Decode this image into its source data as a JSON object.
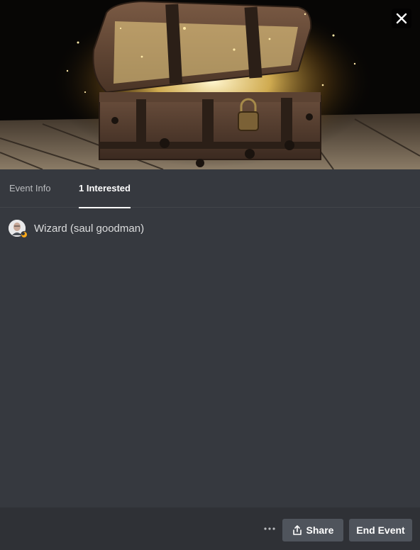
{
  "cover": {
    "image_subject": "open treasure chest glowing with golden light"
  },
  "close": {
    "icon": "close-icon"
  },
  "tabs": [
    {
      "label": "Event Info",
      "active": false
    },
    {
      "label": "1 Interested",
      "active": true
    }
  ],
  "interested": [
    {
      "name": "Wizard (saul goodman)",
      "avatar": "avatar-icon",
      "badge": "moon-status-icon"
    }
  ],
  "footer": {
    "more_label": "•••",
    "share_label": "Share",
    "end_label": "End Event"
  },
  "colors": {
    "background": "#36393f",
    "footer": "#2f3136",
    "button": "#4f545c",
    "idle_status": "#faa81a"
  }
}
